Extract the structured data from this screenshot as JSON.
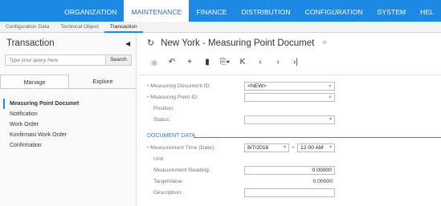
{
  "modules": [
    "ORGANIZATION",
    "MAINTENANCE",
    "FINANCE",
    "DISTRIBUTION",
    "CONFIGURATION",
    "SYSTEM",
    "HEL"
  ],
  "active_module": "MAINTENANCE",
  "subtabs": [
    "Configuration Data",
    "Technical Object",
    "Transaction"
  ],
  "active_subtab": "Transaction",
  "left": {
    "title": "Transaction",
    "search_placeholder": "Type your query here",
    "search_button": "Search",
    "tabs": [
      "Manage",
      "Explore"
    ],
    "items": [
      "Measuring Point Documet",
      "Notification",
      "Work Order",
      "Konfirmasi Work Order",
      "Confirmation"
    ]
  },
  "main": {
    "title": "New York - Measuring Point Documet",
    "labels": {
      "doc_id": "Measuring Document ID:",
      "point_id": "Measuring Point ID:",
      "position": "Position:",
      "status": "Status:",
      "section": "DOCUMENT DATA",
      "time": "Measurement Time (Date):",
      "unit": "Unit:",
      "reading": "Measurement Reading:",
      "target": "TargetValue:",
      "description": "Description:"
    },
    "values": {
      "doc_id": "<NEW>",
      "point_id": "",
      "status": "",
      "date": "8/7/2016",
      "time": "12:00 AM",
      "reading": "0.00000",
      "target": "0.00000",
      "description": ""
    }
  }
}
